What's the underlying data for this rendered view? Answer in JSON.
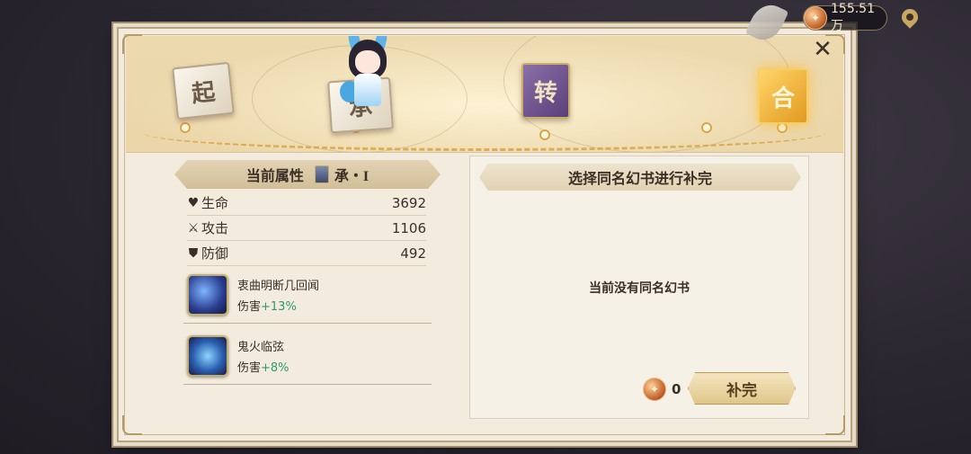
{
  "hud": {
    "currency_amount": "155.51万",
    "coin_symbol": "✦"
  },
  "map": {
    "stages": [
      {
        "label": "起",
        "state": "done"
      },
      {
        "label": "承",
        "state": "current"
      },
      {
        "label": "转",
        "state": "locked"
      },
      {
        "label": "合",
        "state": "highlighted"
      }
    ]
  },
  "attributes": {
    "header": "当前属性",
    "rank": "承・I",
    "stats": [
      {
        "icon": "heart-icon",
        "label": "生命",
        "value": "3692"
      },
      {
        "icon": "sword-icon",
        "label": "攻击",
        "value": "1106"
      },
      {
        "icon": "shield-icon",
        "label": "防御",
        "value": "492"
      }
    ],
    "skills": [
      {
        "icon": "skill-lute-icon",
        "name": "衷曲明断几回闻",
        "effect_prefix": "伤害",
        "effect_bonus": "+13%"
      },
      {
        "icon": "skill-ghostfire-icon",
        "name": "鬼火临弦",
        "effect_prefix": "伤害",
        "effect_bonus": "+8%"
      }
    ]
  },
  "supplement": {
    "header": "选择同名幻书进行补完",
    "empty_text": "当前没有同名幻书",
    "cost_value": "0",
    "button_label": "补完"
  },
  "colors": {
    "bonus_green": "#2c9b6b",
    "frame_gold": "#b9a482",
    "panel_bg": "#f3ecde"
  }
}
